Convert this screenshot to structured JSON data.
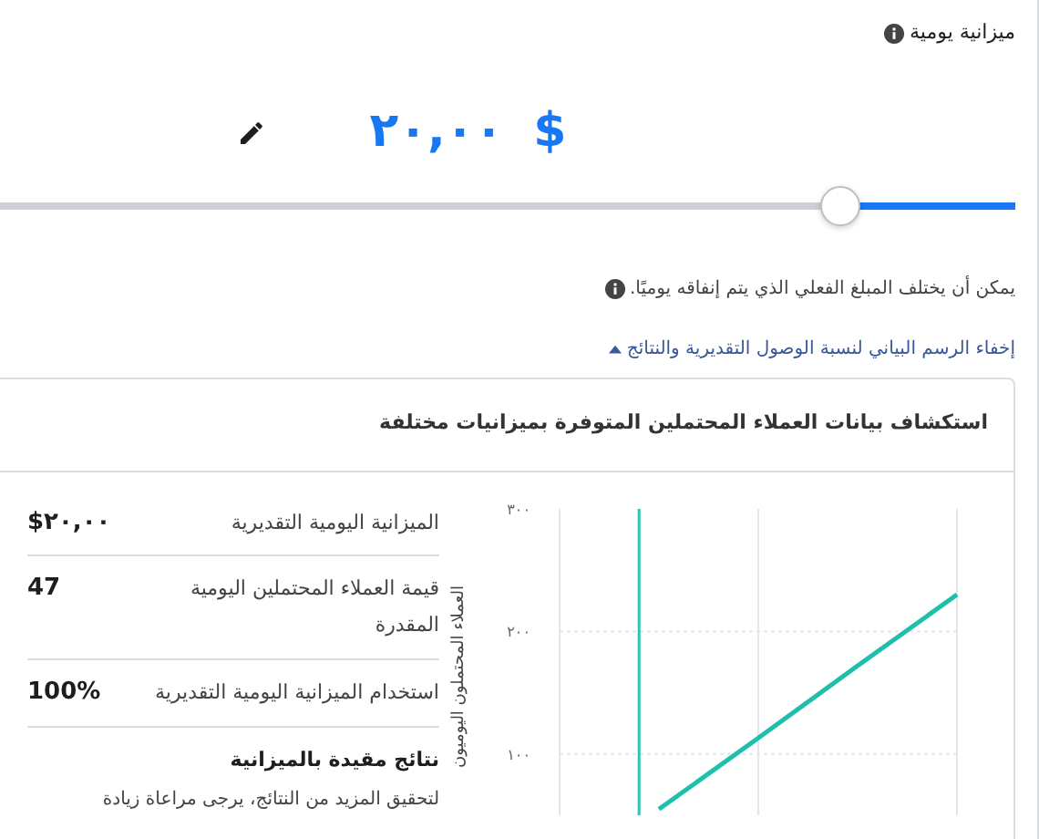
{
  "budget": {
    "title": "ميزانية يومية",
    "amount": "٢٠,٠٠",
    "currency": "$",
    "slider": {
      "level": 0.17
    },
    "note": "يمكن أن يختلف المبلغ الفعلي الذي يتم إنفاقه يوميًا.",
    "toggle_link": "إخفاء الرسم البياني لنسبة الوصول التقديرية والنتائج"
  },
  "card": {
    "title": "استكشاف بيانات العملاء المحتملين المتوفرة بميزانيات مختلفة",
    "stats": [
      {
        "label": "الميزانية اليومية التقديرية",
        "value": "٢٠,٠٠$"
      },
      {
        "label": "قيمة العملاء المحتملين اليومية المقدرة",
        "value": "47"
      },
      {
        "label": "استخدام الميزانية اليومية التقديرية",
        "value": "100%"
      }
    ],
    "notice": {
      "heading": "نتائج مقيدة بالميزانية",
      "text": "لتحقيق المزيد من النتائج، يرجى مراعاة زيادة"
    },
    "chart_data": {
      "type": "line",
      "ylabel": "العملاء المحتملون اليوميون",
      "categories": [
        null,
        null,
        null,
        null,
        null
      ],
      "ylim": [
        50,
        300
      ],
      "yticks": [
        {
          "value": 100,
          "label": "١٠٠"
        },
        {
          "value": 200,
          "label": "٢٠٠"
        },
        {
          "value": 300,
          "label": "٣٠٠"
        }
      ],
      "series": [
        {
          "color": "#1fbfad",
          "values": [
            null,
            55,
            113,
            172,
            230
          ]
        }
      ]
    }
  }
}
